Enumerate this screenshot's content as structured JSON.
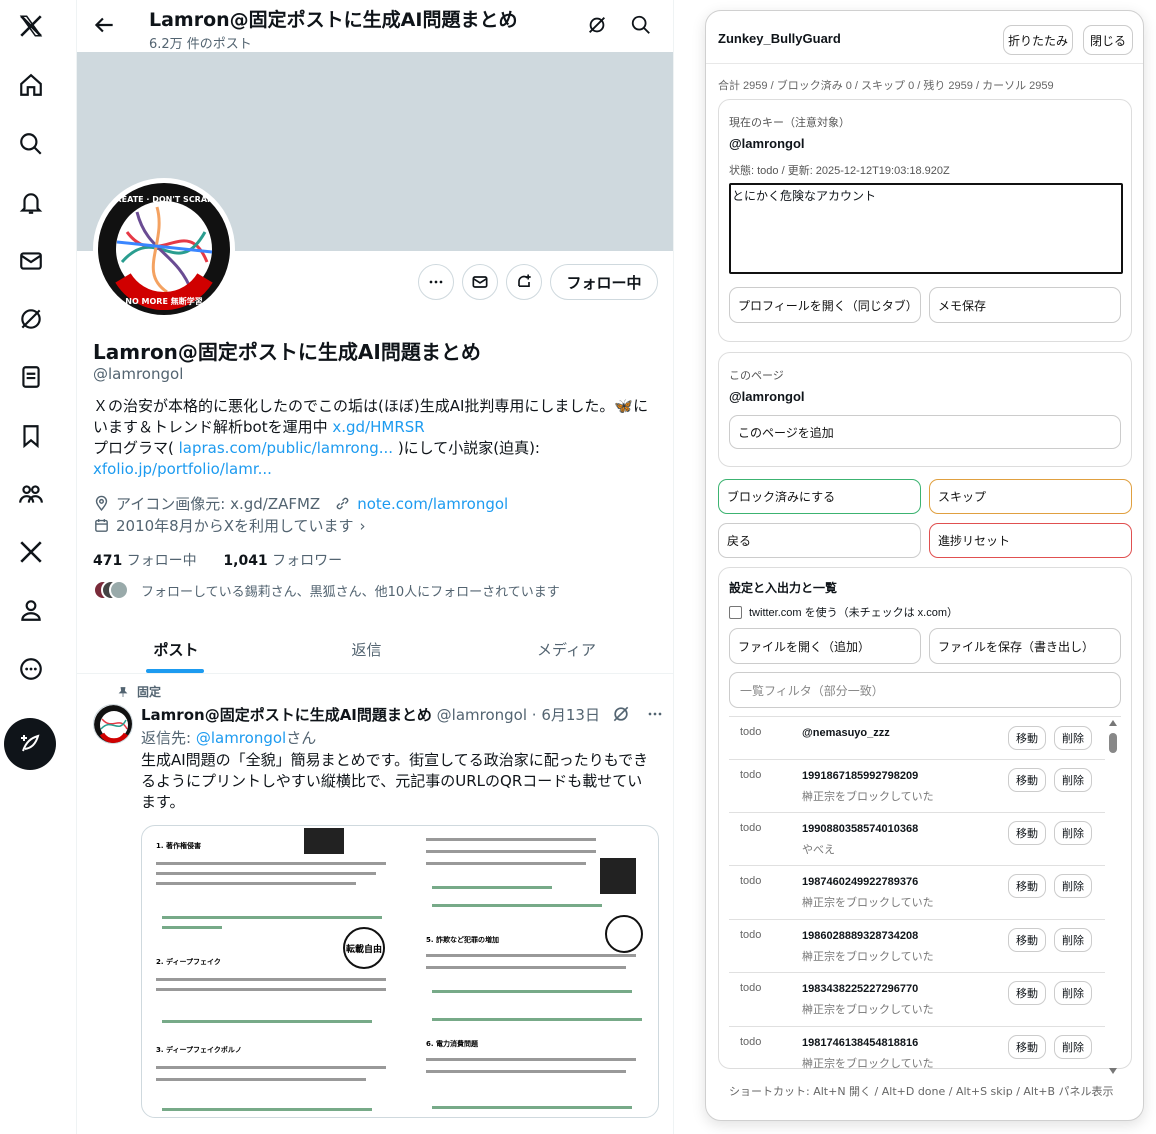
{
  "nav": {
    "items": [
      "x-logo",
      "home",
      "explore",
      "notifications",
      "messages",
      "grok",
      "lists",
      "bookmarks",
      "communities",
      "premium",
      "profile",
      "more"
    ],
    "compose_label": "post"
  },
  "header": {
    "title": "Lamron@固定ポストに生成AI問題まとめ",
    "post_count": "6.2万 件のポスト"
  },
  "profile": {
    "name": "Lamron@固定ポストに生成AI問題まとめ",
    "handle": "@lamrongol",
    "follow_button": "フォロー中",
    "bio_line1": "Ｘの治安が本格的に悪化したのでこの垢は(ほぼ)生成AI批判専用にしました。🦋に",
    "bio_line2a": "います＆トレンド解析botを運用中 ",
    "bio_link1": "x.gd/HMRSR",
    "bio_line3a": "プログラマ( ",
    "bio_link2": "lapras.com/public/lamrong...",
    "bio_line3b": " )にして小説家(迫真):",
    "bio_link3": "xfolio.jp/portfolio/lamr...",
    "location": "アイコン画像元: x.gd/ZAFMZ",
    "website": "note.com/lamrongol",
    "joined": "2010年8月からXを利用しています",
    "following_count": "471",
    "following_label": "フォロー中",
    "followers_count": "1,041",
    "followers_label": "フォロワー",
    "followed_by": "フォローしている錫莉さん、黒狐さん、他10人にフォローされています",
    "avatar_text": "CREATE · DON'T SCRAPE",
    "avatar_text2": "NO MORE 無断学習"
  },
  "tabs": [
    "ポスト",
    "返信",
    "メディア"
  ],
  "pinned_tweet": {
    "pinned_label": "固定",
    "author": "Lamron@固定ポストに生成AI問題まとめ",
    "handle_date": "@lamrongol · 6月13日",
    "reply_prefix": "返信先: ",
    "reply_handle": "@lamrongol",
    "reply_suffix": "さん",
    "text": "生成AI問題の「全貌」簡易まとめです。街宣してる政治家に配ったりもできるようにプリントしやすい縦横比で、元記事のURLのQRコードも載せています。",
    "image_headings": [
      "1. 著作権侵害",
      "2. ディープフェイク",
      "3. ディープフェイクポルノ",
      "5. 詐欺など犯罪の増加",
      "6. 電力消費問題"
    ],
    "stamp": "転載自由"
  },
  "panel": {
    "title": "Zunkey_BullyGuard",
    "collapse_button": "折りたたみ",
    "close_button": "閉じる",
    "summary": "合計 2959 / ブロック済み 0 / スキップ 0 / 残り 2959 / カーソル 2959",
    "current_key_label": "現在のキー（注意対象）",
    "current_key": "@lamrongol",
    "status_line": "状態: todo / 更新: 2025-12-12T19:03:18.920Z",
    "memo_value": "とにかく危険なアカウント",
    "open_profile_button": "プロフィールを開く（同じタブ）",
    "save_memo_button": "メモ保存",
    "this_page_label": "このページ",
    "this_page_key": "@lamrongol",
    "add_page_button": "このページを追加",
    "blocked_button": "ブロック済みにする",
    "skip_button": "スキップ",
    "back_button": "戻る",
    "reset_button": "進捗リセット",
    "settings_title": "設定と入出力と一覧",
    "twitter_checkbox_label": "twitter.com を使う（未チェックは x.com）",
    "open_file_button": "ファイルを開く（追加）",
    "save_file_button": "ファイルを保存（書き出し）",
    "filter_placeholder": "一覧フィルタ（部分一致）",
    "move_label": "移動",
    "delete_label": "削除",
    "list": [
      {
        "status": "todo",
        "key": "@nemasuyo_zzz",
        "memo": ""
      },
      {
        "status": "todo",
        "key": "1991867185992798209",
        "memo": "榊正宗をブロックしていた"
      },
      {
        "status": "todo",
        "key": "1990880358574010368",
        "memo": "やべえ"
      },
      {
        "status": "todo",
        "key": "1987460249922789376",
        "memo": "榊正宗をブロックしていた"
      },
      {
        "status": "todo",
        "key": "1986028889328734208",
        "memo": "榊正宗をブロックしていた"
      },
      {
        "status": "todo",
        "key": "1983438225227296770",
        "memo": "榊正宗をブロックしていた"
      },
      {
        "status": "todo",
        "key": "1981746138454818816",
        "memo": "榊正宗をブロックしていた"
      }
    ],
    "shortcuts": "ショートカット: Alt+N 開く / Alt+D done / Alt+S skip / Alt+B パネル表示"
  },
  "colors": {
    "accent": "#1d9bf0",
    "green_border": "#3cb371",
    "orange_border": "#e0a040",
    "red_border": "#e05050"
  }
}
